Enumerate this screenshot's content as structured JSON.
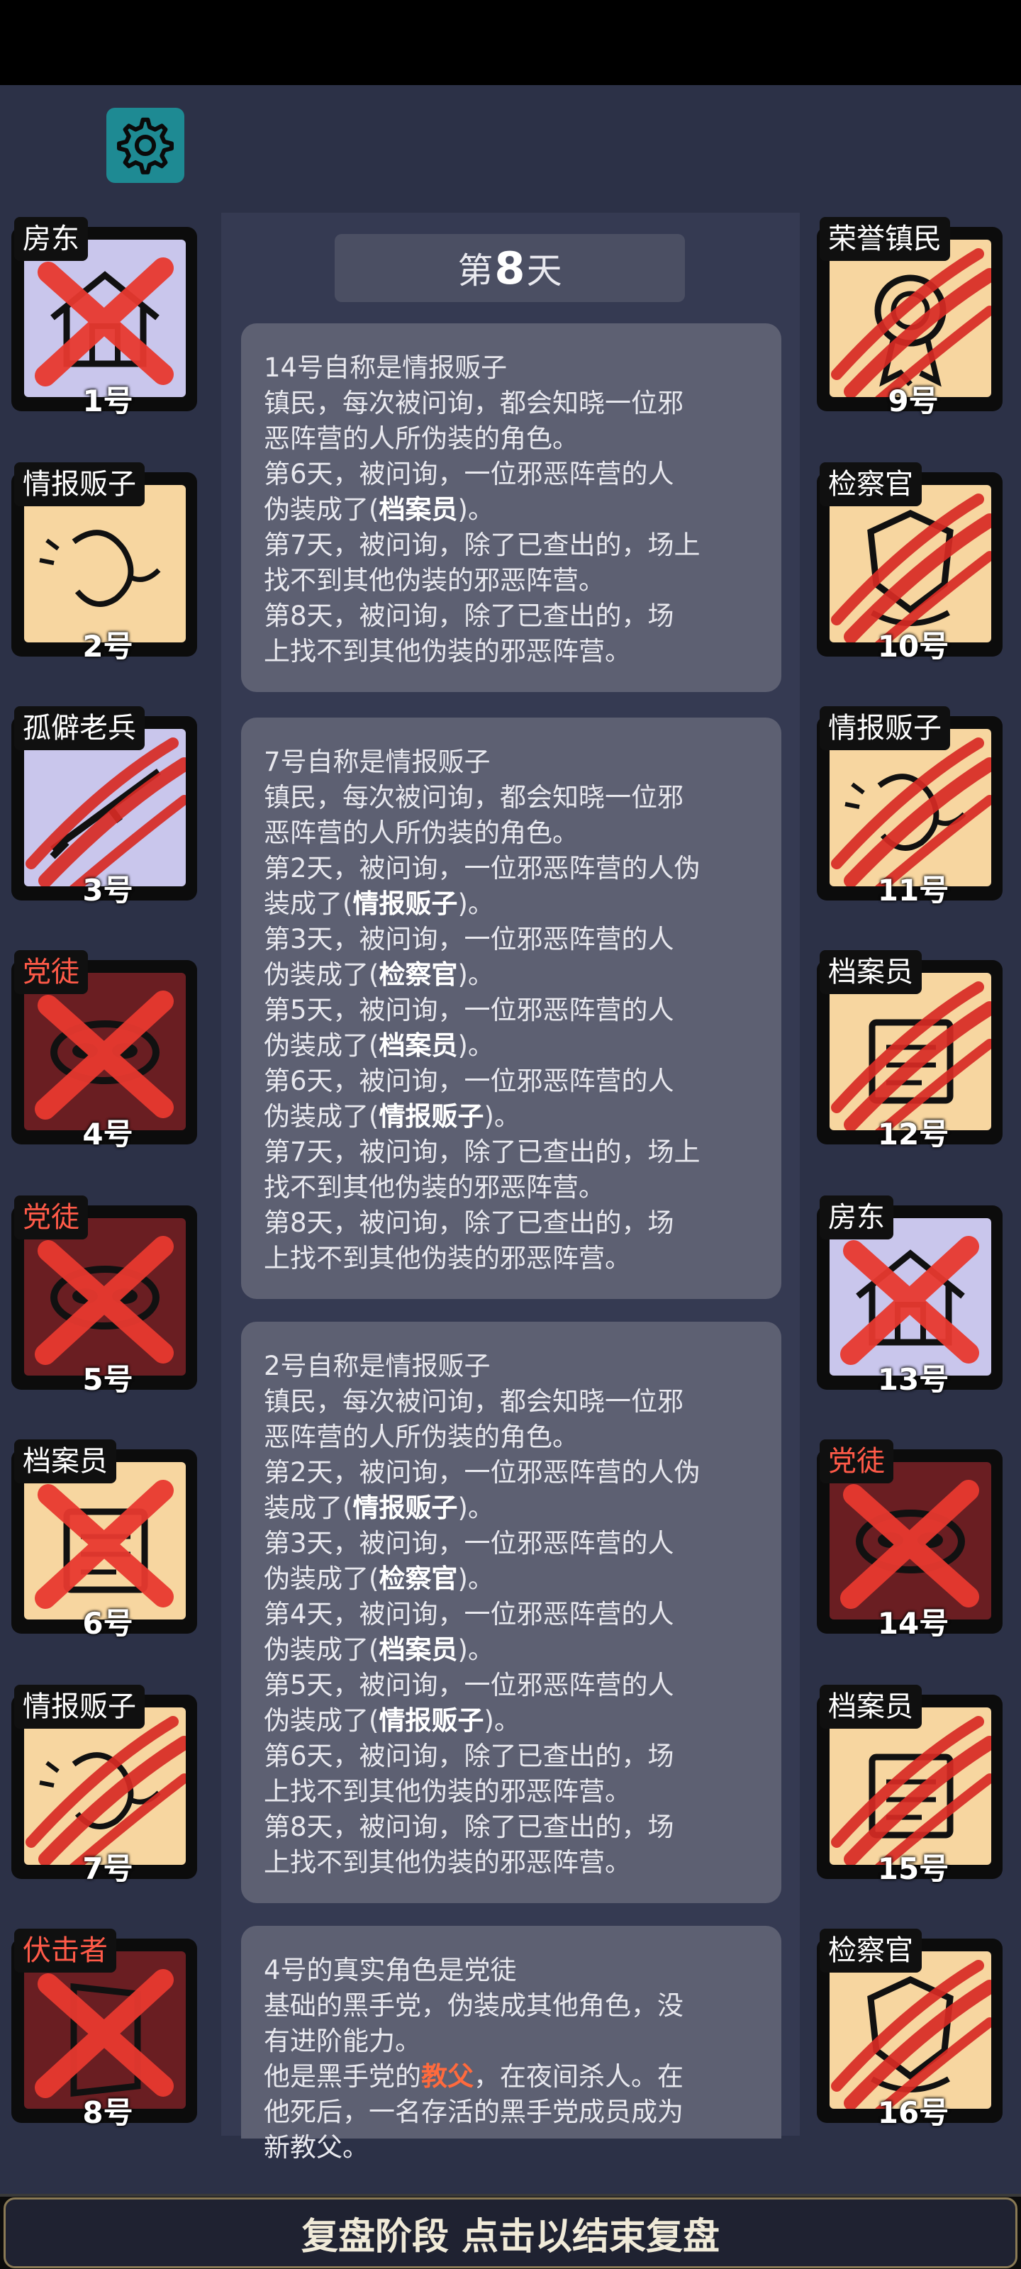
{
  "header": {
    "settings_icon": "gear-icon",
    "accent": "#1e8a93"
  },
  "day": {
    "prefix": "第",
    "number": "8",
    "suffix": "天"
  },
  "messages": [
    {
      "lines": [
        [
          "14号自称是情报贩子"
        ],
        [
          "镇民，每次被问询，都会知晓一位邪"
        ],
        [
          "恶阵营的人所伪装的角色。"
        ],
        [
          "第6天，被问询，一位邪恶阵营的人"
        ],
        [
          "伪装成了(",
          "档案员",
          ")。"
        ],
        [
          "第7天，被问询，除了已查出的，场上"
        ],
        [
          "找不到其他伪装的邪恶阵营。"
        ],
        [
          "第8天，被问询，除了已查出的，场"
        ],
        [
          "上找不到其他伪装的邪恶阵营。"
        ]
      ]
    },
    {
      "lines": [
        [
          "7号自称是情报贩子"
        ],
        [
          "镇民，每次被问询，都会知晓一位邪"
        ],
        [
          "恶阵营的人所伪装的角色。"
        ],
        [
          "第2天，被问询，一位邪恶阵营的人伪"
        ],
        [
          "装成了(",
          "情报贩子",
          ")。"
        ],
        [
          "第3天，被问询，一位邪恶阵营的人"
        ],
        [
          "伪装成了(",
          "检察官",
          ")。"
        ],
        [
          "第5天，被问询，一位邪恶阵营的人"
        ],
        [
          "伪装成了(",
          "档案员",
          ")。"
        ],
        [
          "第6天，被问询，一位邪恶阵营的人"
        ],
        [
          "伪装成了(",
          "情报贩子",
          ")。"
        ],
        [
          "第7天，被问询，除了已查出的，场上"
        ],
        [
          "找不到其他伪装的邪恶阵营。"
        ],
        [
          "第8天，被问询，除了已查出的，场"
        ],
        [
          "上找不到其他伪装的邪恶阵营。"
        ]
      ]
    },
    {
      "lines": [
        [
          "2号自称是情报贩子"
        ],
        [
          "镇民，每次被问询，都会知晓一位邪"
        ],
        [
          "恶阵营的人所伪装的角色。"
        ],
        [
          "第2天，被问询，一位邪恶阵营的人伪"
        ],
        [
          "装成了(",
          "情报贩子",
          ")。"
        ],
        [
          "第3天，被问询，一位邪恶阵营的人"
        ],
        [
          "伪装成了(",
          "检察官",
          ")。"
        ],
        [
          "第4天，被问询，一位邪恶阵营的人"
        ],
        [
          "伪装成了(",
          "档案员",
          ")。"
        ],
        [
          "第5天，被问询，一位邪恶阵营的人"
        ],
        [
          "伪装成了(",
          "情报贩子",
          ")。"
        ],
        [
          "第6天，被问询，除了已查出的，场"
        ],
        [
          "上找不到其他伪装的邪恶阵营。"
        ],
        [
          "第8天，被问询，除了已查出的，场"
        ],
        [
          "上找不到其他伪装的邪恶阵营。"
        ]
      ]
    },
    {
      "lines": [
        [
          "4号的真实角色是党徒"
        ],
        [
          "基础的黑手党，伪装成其他角色，没"
        ],
        [
          "有进阶能力。"
        ],
        [
          "他是黑手党的",
          "教父",
          "，在夜间杀人。在"
        ],
        [
          "他死后，一名存活的黑手党成员成为"
        ],
        [
          "新教父。"
        ]
      ]
    }
  ],
  "left_cards": [
    {
      "role": "房东",
      "seat": "1号",
      "bg": "lavender",
      "mark": "x",
      "role_red": false,
      "icon": "house-icon"
    },
    {
      "role": "情报贩子",
      "seat": "2号",
      "bg": "beige",
      "mark": "none",
      "role_red": false,
      "icon": "whisper-icon"
    },
    {
      "role": "孤僻老兵",
      "seat": "3号",
      "bg": "lavender",
      "mark": "claw",
      "role_red": false,
      "icon": "rifle-icon"
    },
    {
      "role": "党徒",
      "seat": "4号",
      "bg": "maroon",
      "mark": "x",
      "role_red": true,
      "icon": "mask-icon"
    },
    {
      "role": "党徒",
      "seat": "5号",
      "bg": "maroon",
      "mark": "x",
      "role_red": true,
      "icon": "mask-icon"
    },
    {
      "role": "档案员",
      "seat": "6号",
      "bg": "beige",
      "mark": "x",
      "role_red": false,
      "icon": "folder-icon"
    },
    {
      "role": "情报贩子",
      "seat": "7号",
      "bg": "beige",
      "mark": "claw",
      "role_red": false,
      "icon": "whisper-icon"
    },
    {
      "role": "伏击者",
      "seat": "8号",
      "bg": "maroon",
      "mark": "x",
      "role_red": true,
      "icon": "door-icon"
    }
  ],
  "right_cards": [
    {
      "role": "荣誉镇民",
      "seat": "9号",
      "bg": "beige",
      "mark": "claw",
      "role_red": false,
      "icon": "medal-icon"
    },
    {
      "role": "检察官",
      "seat": "10号",
      "bg": "beige",
      "mark": "claw",
      "role_red": false,
      "icon": "badge-icon"
    },
    {
      "role": "情报贩子",
      "seat": "11号",
      "bg": "beige",
      "mark": "claw",
      "role_red": false,
      "icon": "whisper-icon"
    },
    {
      "role": "档案员",
      "seat": "12号",
      "bg": "beige",
      "mark": "claw",
      "role_red": false,
      "icon": "folder-icon"
    },
    {
      "role": "房东",
      "seat": "13号",
      "bg": "lavender",
      "mark": "x",
      "role_red": false,
      "icon": "house-icon"
    },
    {
      "role": "党徒",
      "seat": "14号",
      "bg": "maroon",
      "mark": "x",
      "role_red": true,
      "icon": "mask-icon"
    },
    {
      "role": "档案员",
      "seat": "15号",
      "bg": "beige",
      "mark": "claw",
      "role_red": false,
      "icon": "folder-icon"
    },
    {
      "role": "检察官",
      "seat": "16号",
      "bg": "beige",
      "mark": "claw",
      "role_red": false,
      "icon": "badge-icon"
    }
  ],
  "footer": {
    "label": "复盘阶段 点击以结束复盘"
  }
}
